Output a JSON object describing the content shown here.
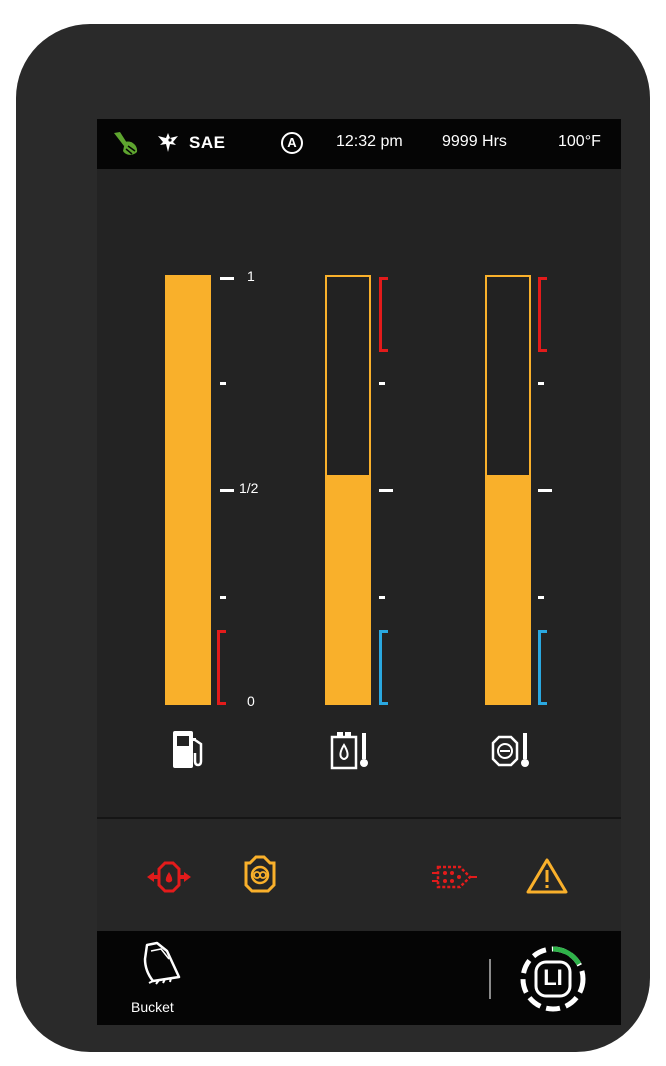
{
  "status_bar": {
    "work_mode_icon": "excavator-arm-icon",
    "machine_icon": "eagle-icon",
    "units": "SAE",
    "auto_mode": "A",
    "time": "12:32 pm",
    "hours": "9999 Hrs",
    "temperature": "100°F"
  },
  "gauges": [
    {
      "name": "fuel",
      "icon": "fuel-pump-icon",
      "level": 1.0,
      "scale_labels": {
        "top": "1",
        "middle": "1/2",
        "bottom": "0"
      },
      "low_zone_color": "#e31b1b"
    },
    {
      "name": "hydraulic-oil-temperature",
      "icon": "hydraulic-temp-icon",
      "level": 0.535,
      "hot_zone_color": "#e31b1b",
      "cold_zone_color": "#2aa8e0"
    },
    {
      "name": "engine-coolant-temperature",
      "icon": "coolant-temp-icon",
      "level": 0.535,
      "hot_zone_color": "#e31b1b",
      "cold_zone_color": "#2aa8e0"
    }
  ],
  "warnings": [
    {
      "icon": "engine-oil-pressure-icon",
      "color": "#e31b1b"
    },
    {
      "icon": "engine-check-icon",
      "color": "#f9b02b"
    },
    {
      "icon": "diesel-particulate-filter-icon",
      "color": "#e31b1b"
    },
    {
      "icon": "caution-triangle-icon",
      "color": "#f9b02b"
    }
  ],
  "bottom_bar": {
    "attachment_label": "Bucket",
    "attachment_icon": "bucket-icon",
    "lift_mode_label": "LI",
    "lift_mode_icon": "lift-mode-dial-icon"
  },
  "colors": {
    "gauge_fill": "#f9b02b",
    "danger": "#e31b1b",
    "cold": "#2aa8e0",
    "accent_green": "#5ea52f"
  }
}
